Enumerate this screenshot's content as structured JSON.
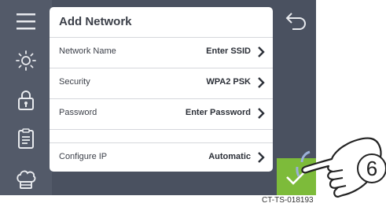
{
  "panel": {
    "title": "Add Network",
    "rows": [
      {
        "label": "Network Name",
        "value": "Enter SSID"
      },
      {
        "label": "Security",
        "value": "WPA2 PSK"
      },
      {
        "label": "Password",
        "value": "Enter Password"
      },
      {
        "label": "Configure IP",
        "value": "Automatic"
      }
    ]
  },
  "sidebar": {
    "icons": [
      "menu-icon",
      "brightness-icon",
      "lock-icon",
      "clipboard-icon",
      "chef-hat-icon"
    ]
  },
  "callout": {
    "step_number": "6"
  },
  "footer": {
    "reference_code": "CT-TS-018193"
  },
  "colors": {
    "device_background": "#4a5160",
    "sidebar_background": "#535a69",
    "confirm_button": "#7dbb3a",
    "panel_background": "#ffffff"
  }
}
